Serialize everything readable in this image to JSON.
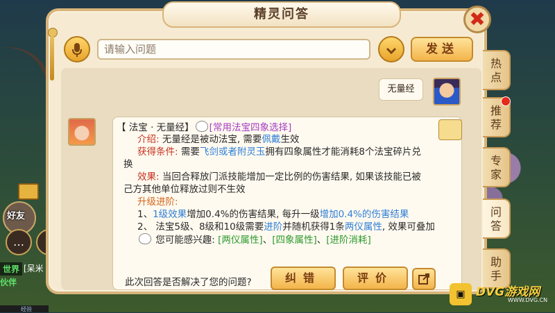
{
  "dialog": {
    "title": "精灵问答",
    "close_label": "✖"
  },
  "input": {
    "placeholder": "请输入问题",
    "send_label": "发送"
  },
  "chat": {
    "user_question": "无量经",
    "answer": {
      "header_prefix": "【 法宝 · 无量经】",
      "header_link": "[常用法宝四象选择]",
      "intro_label": "介绍:",
      "intro_text": " 无量经是被动法宝, 需要",
      "intro_link": "佩戴",
      "intro_tail": "生效",
      "cond_label": "获得条件:",
      "cond_text1": " 需要",
      "cond_link": "飞剑或者附灵玉",
      "cond_text2": "拥有四象属性才能消耗8个法宝碎片兑",
      "cond_text3": "换",
      "effect_label": "效果:",
      "effect_text1": " 当回合释放门派技能增加一定比例的伤害结果, 如果该技能已被",
      "effect_text2": "己方其他单位释放过则不生效",
      "upgrade_label": "升级进阶:",
      "up1_prefix": "1、",
      "up1_link1": "1级效果",
      "up1_mid": "增加0.4%的伤害结果, 每升一级",
      "up1_link2": "增加0.4%的伤害结果",
      "up2_prefix": "2、 法宝5级、8级和10级需要",
      "up2_link1": "进阶",
      "up2_mid": "并随机获得1条",
      "up2_link2": "两仪属性",
      "up2_tail": ", 效果可叠加",
      "interest_text": " 您可能感兴趣: ",
      "interest_link1": "[两仪属性]",
      "interest_sep1": "、",
      "interest_link2": "[四象属性]",
      "interest_sep2": "、",
      "interest_link3": "[进阶消耗]"
    },
    "solved_question": "此次回答是否解决了您的问题?",
    "fix_label": "纠错",
    "rate_label": "评价"
  },
  "side_tabs": [
    {
      "label": "热\n点"
    },
    {
      "label": "推\n荐"
    },
    {
      "label": "专\n家"
    },
    {
      "label": "问\n答"
    },
    {
      "label": "助\n手"
    }
  ],
  "hud": {
    "friend_label": "好友",
    "world_label": "世界",
    "world_msg": "[呆米",
    "partner_label": "伙伴",
    "exp_label": "经验"
  },
  "watermark": {
    "icon": "▣",
    "brand": "DVG游戏网",
    "url": "WWW.DVG.CN"
  },
  "colors": {
    "accent": "#f3b44a",
    "link_blue": "#2f7fd6",
    "label_red": "#c4321e",
    "link_purple": "#a43ec2",
    "link_green": "#2c9a2c"
  },
  "icons": {
    "mic": "mic-icon",
    "dropdown": "chevron-down-icon",
    "close": "close-icon",
    "share": "share-icon",
    "book": "book-icon"
  }
}
